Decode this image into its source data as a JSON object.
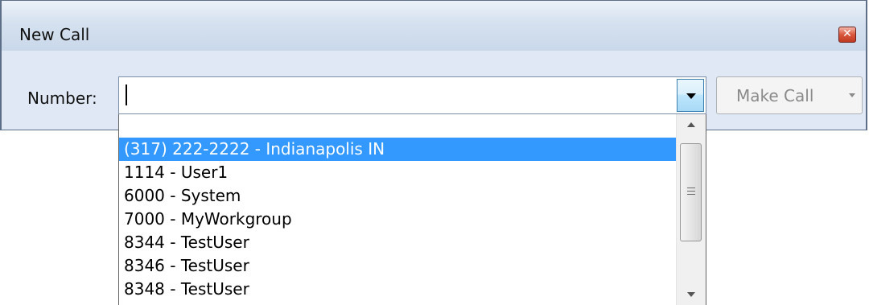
{
  "window": {
    "title": "New Call",
    "close_label": "✕"
  },
  "form": {
    "number_label": "Number:",
    "number_value": "",
    "make_call_label": "Make Call"
  },
  "dropdown": {
    "selected_index": 1,
    "items": [
      "",
      "(317) 222-2222 - Indianapolis IN",
      "1114 - User1",
      "6000 - System",
      "7000 - MyWorkgroup",
      "8344 - TestUser",
      "8346 - TestUser",
      "8348 - TestUser"
    ]
  },
  "colors": {
    "selection": "#3399ff",
    "window_bg": "#dfe8f4"
  }
}
